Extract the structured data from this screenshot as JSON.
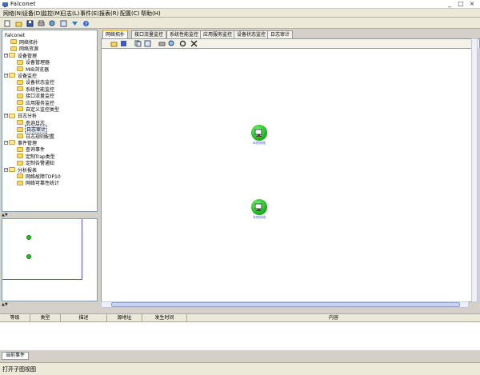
{
  "window": {
    "title": "Falconet",
    "controls": [
      "_",
      "□",
      "×"
    ]
  },
  "menu": [
    {
      "label": "网络(N)"
    },
    {
      "label": "设备(D)"
    },
    {
      "label": "监控(M)"
    },
    {
      "label": "日志(L)"
    },
    {
      "label": "事件(E)"
    },
    {
      "label": "报表(R)"
    },
    {
      "label": "配置(C)"
    },
    {
      "label": "帮助(H)"
    }
  ],
  "toolbar": {
    "icons": [
      "new-icon",
      "open-icon",
      "save-icon",
      "print-icon",
      "preview-icon",
      "refresh-icon",
      "down-icon",
      "help-icon"
    ]
  },
  "tree": [
    {
      "label": "Falconet",
      "level": 0,
      "expander": "",
      "folder": false
    },
    {
      "label": "网络拓扑",
      "level": 1,
      "expander": "",
      "folder": true
    },
    {
      "label": "网络资源",
      "level": 1,
      "expander": "",
      "folder": true
    },
    {
      "label": "设备管理",
      "level": 0,
      "expander": "−",
      "folder": true
    },
    {
      "label": "设备管理器",
      "level": 2,
      "expander": "",
      "folder": true
    },
    {
      "label": "MIB浏览器",
      "level": 2,
      "expander": "",
      "folder": true
    },
    {
      "label": "设备监控",
      "level": 0,
      "expander": "−",
      "folder": true
    },
    {
      "label": "设备状态监控",
      "level": 2,
      "expander": "",
      "folder": true
    },
    {
      "label": "系统性能监控",
      "level": 2,
      "expander": "",
      "folder": true
    },
    {
      "label": "接口流量监控",
      "level": 2,
      "expander": "",
      "folder": true
    },
    {
      "label": "应用服务监控",
      "level": 2,
      "expander": "",
      "folder": true
    },
    {
      "label": "自定义监控类型",
      "level": 2,
      "expander": "",
      "folder": true
    },
    {
      "label": "日志分析",
      "level": 0,
      "expander": "−",
      "folder": true
    },
    {
      "label": "查询日志",
      "level": 2,
      "expander": "",
      "folder": true
    },
    {
      "label": "日志审计",
      "level": 2,
      "expander": "",
      "folder": true,
      "selected": true
    },
    {
      "label": "日志规则配置",
      "level": 2,
      "expander": "",
      "folder": true
    },
    {
      "label": "事件管理",
      "level": 0,
      "expander": "−",
      "folder": true
    },
    {
      "label": "查询事件",
      "level": 2,
      "expander": "",
      "folder": true
    },
    {
      "label": "定制Trap类型",
      "level": 2,
      "expander": "",
      "folder": true
    },
    {
      "label": "定制告警通知",
      "level": 2,
      "expander": "",
      "folder": true
    },
    {
      "label": "分析报表",
      "level": 0,
      "expander": "−",
      "folder": true
    },
    {
      "label": "网络故障TOP10",
      "level": 2,
      "expander": "",
      "folder": true
    },
    {
      "label": "网络可靠性统计",
      "level": 2,
      "expander": "",
      "folder": true
    }
  ],
  "tabs": [
    {
      "label": "网络拓扑",
      "active": true
    },
    {
      "label": "接口流量监控",
      "active": false
    },
    {
      "label": "系统性能监控",
      "active": false
    },
    {
      "label": "应用服务监控",
      "active": false
    },
    {
      "label": "设备状态监控",
      "active": false
    },
    {
      "label": "日志审计",
      "active": false
    }
  ],
  "canvas_toolbar": {
    "icons": [
      "folder-icon",
      "save-icon",
      "copy-icon",
      "paste-icon",
      "print-icon",
      "zoom-icon",
      "settings-icon",
      "close-icon"
    ]
  },
  "nodes": [
    {
      "label": "本地网络"
    },
    {
      "label": "本地网络"
    }
  ],
  "events_table": {
    "columns": [
      "等级",
      "类型",
      "描述",
      "源地址",
      "发生时间",
      "内容"
    ]
  },
  "bottom_tab": "当前事件",
  "status": "打开子图视图",
  "colors": {
    "node_green": "#1fb51f",
    "tab_active_accent": "#ffc83c",
    "selection_border": "#5a5adc"
  }
}
